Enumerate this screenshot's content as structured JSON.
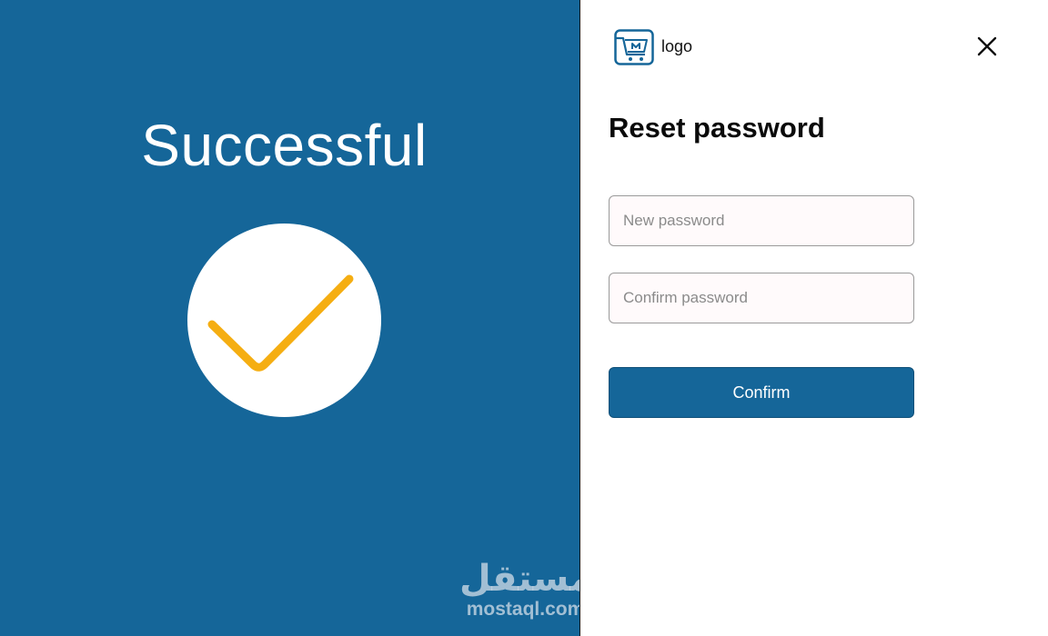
{
  "left": {
    "title": "Successful",
    "watermark": {
      "arabic": "مستقل",
      "latin": "mostaql.com"
    }
  },
  "colors": {
    "brand": "#156699",
    "check": "#f5ae12"
  },
  "header": {
    "logo_label": "logo",
    "logo_icon": "shopping-cart-icon",
    "close_icon": "close-icon"
  },
  "form": {
    "title": "Reset password",
    "new_password": {
      "placeholder": "New password",
      "value": ""
    },
    "confirm_password": {
      "placeholder": "Confirm password",
      "value": ""
    },
    "confirm_label": "Confirm"
  }
}
